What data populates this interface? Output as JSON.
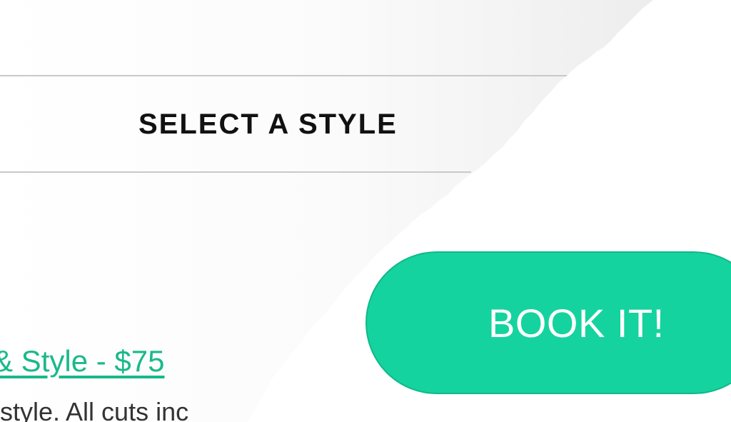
{
  "section": {
    "title": "SELECT A STYLE"
  },
  "service": {
    "link_text": "& Style - $75",
    "description": "style. All cuts inc"
  },
  "cta": {
    "label": "BOOK IT!"
  },
  "colors": {
    "accent": "#15d39f",
    "link": "#19b98b",
    "text": "#111111"
  }
}
